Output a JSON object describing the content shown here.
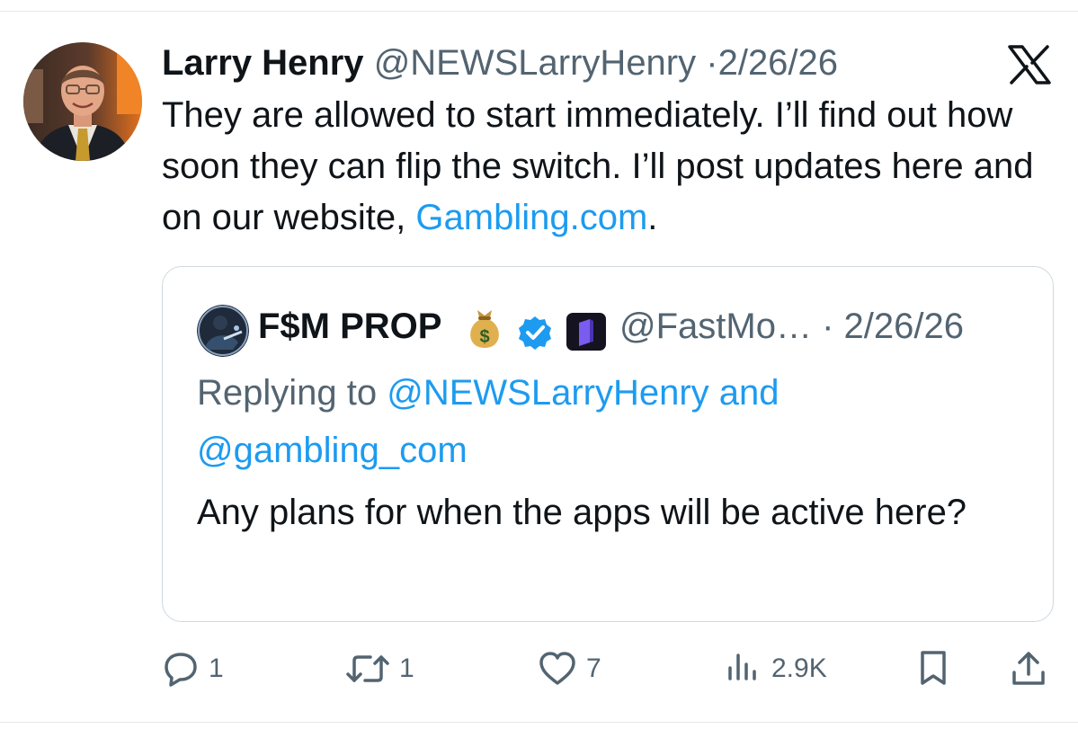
{
  "post": {
    "author_name": "Larry Henry",
    "author_handle": "@NEWSLarryHenry",
    "separator": "·",
    "date": "2/26/26",
    "text_main": "They are allowed to start immediately. I’ll find out how soon they can flip the switch. I’ll post updates here and on our website, ",
    "text_link": "Gambling.com",
    "text_end": "."
  },
  "quote": {
    "author_name": "F$M PROP",
    "handle_date": "@FastMo… · 2/26/26",
    "reply_prefix": "Replying to ",
    "reply_mention_1": "@NEWSLarryHenry",
    "reply_and": " and ",
    "reply_mention_2": "@gambling_com",
    "text": "Any plans for when the apps will be active here?"
  },
  "actions": {
    "replies": "1",
    "reposts": "1",
    "likes": "7",
    "views": "2.9K"
  },
  "icons": {
    "platform": "x-logo-icon",
    "reply": "reply-icon",
    "repost": "repost-icon",
    "like": "heart-icon",
    "views": "views-icon",
    "bookmark": "bookmark-icon",
    "share": "share-icon",
    "verified": "verified-badge-icon",
    "emoji": "money-bag-icon",
    "brand": "brand-logo-icon"
  },
  "colors": {
    "text": "#0f1419",
    "secondary": "#536471",
    "link": "#1d9bf0",
    "border": "#cfd9de"
  }
}
